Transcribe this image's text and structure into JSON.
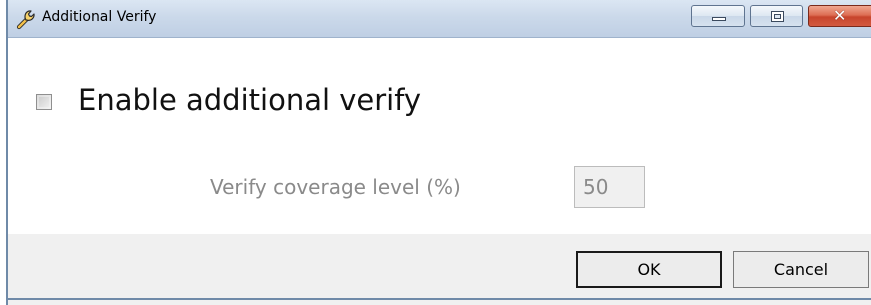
{
  "window": {
    "title": "Additional Verify",
    "icon": "wrench-icon",
    "caption_buttons": [
      "minimize-icon",
      "maximize-icon",
      "close-icon"
    ],
    "close_glyph": "✕"
  },
  "form": {
    "enable_checkbox": {
      "label": "Enable additional verify",
      "checked": false
    },
    "coverage": {
      "label": "Verify coverage level (%)",
      "value": "50",
      "disabled": true
    }
  },
  "buttons": {
    "ok_label": "OK",
    "cancel_label": "Cancel"
  },
  "colors": {
    "titlebar": "#cbd9ea",
    "close_button": "#c7452c",
    "footer_background": "#f0f0f0",
    "disabled_text": "#8a8a8a"
  }
}
